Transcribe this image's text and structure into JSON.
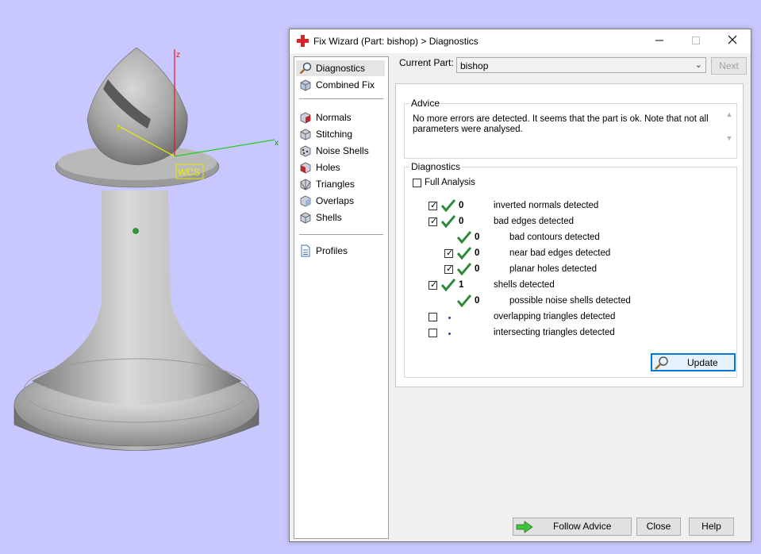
{
  "viewport": {
    "axis_z": "z",
    "axis_x": "x",
    "axis_y": "y",
    "wcs_label": "WCS"
  },
  "dialog": {
    "title": "Fix Wizard (Part: bishop) > Diagnostics",
    "sidebar": {
      "items": [
        {
          "label": "Diagnostics",
          "icon": "magnifier-icon"
        },
        {
          "label": "Combined Fix",
          "icon": "combined-fix-icon"
        },
        {
          "label": "Normals",
          "icon": "normals-cube-icon"
        },
        {
          "label": "Stitching",
          "icon": "stitching-cube-icon"
        },
        {
          "label": "Noise Shells",
          "icon": "noise-shells-cube-icon"
        },
        {
          "label": "Holes",
          "icon": "holes-cube-icon"
        },
        {
          "label": "Triangles",
          "icon": "triangles-cube-icon"
        },
        {
          "label": "Overlaps",
          "icon": "overlaps-cube-icon"
        },
        {
          "label": "Shells",
          "icon": "shells-cube-icon"
        },
        {
          "label": "Profiles",
          "icon": "document-icon"
        }
      ]
    },
    "current_part_label": "Current Part:",
    "current_part_value": "bishop",
    "next_label": "Next",
    "advice": {
      "title": "Advice",
      "text": "No more errors are detected. It seems that the part is ok. Note that not all parameters were analysed."
    },
    "diagnostics": {
      "title": "Diagnostics",
      "full_analysis_label": "Full Analysis",
      "rows": [
        {
          "checkbox": true,
          "status": "ok",
          "count": "0",
          "label": "inverted normals detected"
        },
        {
          "checkbox": true,
          "status": "ok",
          "count": "0",
          "label": "bad edges detected"
        },
        {
          "checkbox": null,
          "status": "ok",
          "count": "0",
          "label": "bad contours detected"
        },
        {
          "checkbox": true,
          "status": "ok",
          "count": "0",
          "label": "near bad edges detected"
        },
        {
          "checkbox": true,
          "status": "ok",
          "count": "0",
          "label": "planar holes detected"
        },
        {
          "checkbox": true,
          "status": "ok",
          "count": "1",
          "label": "shells detected"
        },
        {
          "checkbox": null,
          "status": "ok",
          "count": "0",
          "label": "possible noise shells detected"
        },
        {
          "checkbox": false,
          "status": "pending",
          "count": "",
          "label": "overlapping triangles detected"
        },
        {
          "checkbox": false,
          "status": "pending",
          "count": "",
          "label": "intersecting triangles detected"
        }
      ],
      "update_label": "Update"
    },
    "buttons": {
      "follow_advice": "Follow Advice",
      "close": "Close",
      "help": "Help"
    },
    "colors": {
      "check_green": "#2e8b3a",
      "focus_blue": "#0078d7",
      "titlebar_icon_red": "#d8262b"
    }
  }
}
